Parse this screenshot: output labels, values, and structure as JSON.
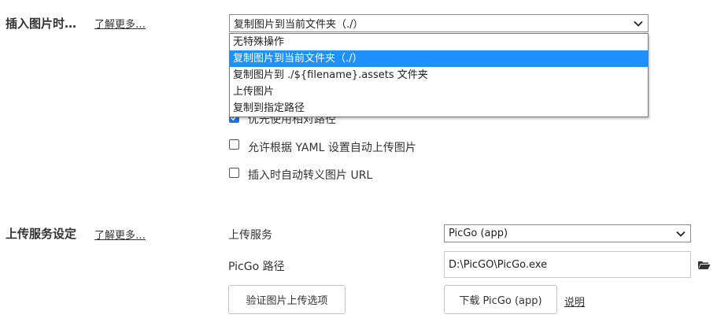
{
  "image_insert": {
    "title": "插入图片时…",
    "learn_more": "了解更多…",
    "select_value": "复制图片到当前文件夹（./）",
    "options": [
      "无特殊操作",
      "复制图片到当前文件夹（./）",
      "复制图片到 ./${filename}.assets 文件夹",
      "上传图片",
      "复制到指定路径"
    ],
    "selected_option_index": 1,
    "checkboxes": [
      {
        "label": "优先使用相对路径",
        "checked": true
      },
      {
        "label": "允许根据 YAML 设置自动上传图片",
        "checked": false
      },
      {
        "label": "插入时自动转义图片 URL",
        "checked": false
      }
    ]
  },
  "upload_service": {
    "title": "上传服务设定",
    "learn_more": "了解更多…",
    "service_label": "上传服务",
    "service_value": "PicGo (app)",
    "path_label": "PicGo 路径",
    "path_value": "D:\\PicGO\\PicGo.exe",
    "verify_button": "验证图片上传选项",
    "download_button": "下载 PicGo (app)",
    "help_link": "说明"
  },
  "icons": {
    "chevron": "chevron-down-icon",
    "folder": "folder-icon"
  }
}
